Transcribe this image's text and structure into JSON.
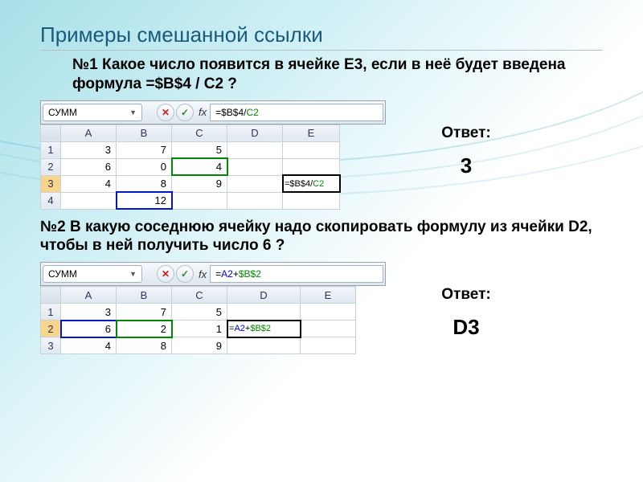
{
  "title": "Примеры смешанной ссылки",
  "q1": {
    "text": "№1 Какое число появится в ячейке  E3, если в неё будет введена формула  =$B$4 / C2 ?",
    "answer_label": "Ответ:",
    "answer_value": "3"
  },
  "q2": {
    "text": "№2 В какую соседнюю ячейку надо скопировать формулу из ячейки D2, чтобы в ней получить число  6 ?",
    "answer_label": "Ответ:",
    "answer_value": "D3"
  },
  "excel1": {
    "namebox": "СУММ",
    "fx_label": "fx",
    "formula_plain": "=$B$4/",
    "formula_ref_green": "C2",
    "headers": [
      "A",
      "B",
      "C",
      "D",
      "E"
    ],
    "rows": [
      {
        "n": "1",
        "cells": [
          "3",
          "7",
          "5",
          "",
          ""
        ]
      },
      {
        "n": "2",
        "cells": [
          "6",
          "0",
          "4",
          "",
          ""
        ]
      },
      {
        "n": "3",
        "cells": [
          "4",
          "8",
          "9",
          "",
          "=$B$4/C2"
        ]
      },
      {
        "n": "4",
        "cells": [
          "",
          "12",
          "",
          "",
          ""
        ]
      }
    ]
  },
  "excel2": {
    "namebox": "СУММ",
    "fx_label": "fx",
    "formula_ref_blue": "A2",
    "formula_plain_mid": "+",
    "formula_plain_pre": "=",
    "formula_ref_green": "$B$2",
    "headers": [
      "A",
      "B",
      "C",
      "D",
      "E"
    ],
    "rows": [
      {
        "n": "1",
        "cells": [
          "3",
          "7",
          "5",
          "",
          ""
        ]
      },
      {
        "n": "2",
        "cells": [
          "6",
          "2",
          "1",
          "=A2+$B$2",
          ""
        ]
      },
      {
        "n": "3",
        "cells": [
          "4",
          "8",
          "9",
          "",
          ""
        ]
      }
    ]
  }
}
